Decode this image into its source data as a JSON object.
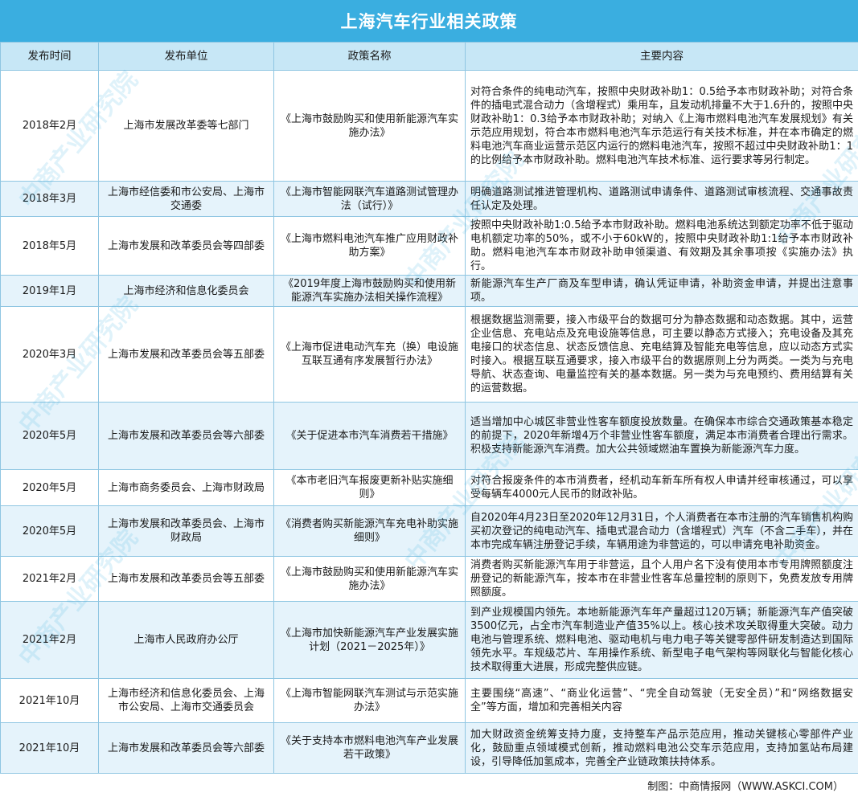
{
  "title": "上海汽车行业相关政策",
  "headers": [
    "发布时间",
    "发布单位",
    "政策名称",
    "主要内容"
  ],
  "rows": [
    {
      "date": "2018年2月",
      "org": "上海市发展改革委等七部门",
      "name": "《上海市鼓励购买和使用新能源汽车实施办法》",
      "content": "对符合条件的纯电动汽车，按照中央财政补助1：0.5给予本市财政补助；对符合条件的插电式混合动力（含增程式）乘用车，且发动机排量不大于1.6升的，按照中央财政补助1：0.3给予本市财政补助；对纳入《上海市燃料电池汽车发展规划》有关示范应用规划，符合本市燃料电池汽车示范运行有关技术标准，并在本市确定的燃料电池汽车商业运营示范区内运行的燃料电池汽车，按照不超过中央财政补助1：1的比例给予本市财政补助。燃料电池汽车技术标准、运行要求等另行制定。"
    },
    {
      "date": "2018年3月",
      "org": "上海市经信委和市公安局、上海市交通委",
      "name": "《上海市智能网联汽车道路测试管理办法（试行）》",
      "content": "明确道路测试推进管理机构、道路测试申请条件、道路测试审核流程、交通事故责任认定及处理。"
    },
    {
      "date": "2018年5月",
      "org": "上海市发展和改革委员会等四部委",
      "name": "《上海市燃料电池汽车推广应用财政补助方案》",
      "content": "按照中央财政补助1:0.5给予本市财政补助。燃料电池系统达到额定功率不低于驱动电机额定功率的50%，或不小于60kW的，按照中央财政补助1:1给予本市财政补助。燃料电池汽车本市财政补助申领渠道、有效期及其余事项按《实施办法》执行。"
    },
    {
      "date": "2019年1月",
      "org": "上海市经济和信息化委员会",
      "name": "《2019年度上海市鼓励购买和使用新能源汽车实施办法相关操作流程》",
      "content": "新能源汽车生产厂商及车型申请，确认凭证申请，补助资金申请，并提出注意事项。"
    },
    {
      "date": "2020年3月",
      "org": "上海市发展和改革委员会等五部委",
      "name": "《上海市促进电动汽车充（换）电设施互联互通有序发展暂行办法》",
      "content": "根据数据监测需要，接入市级平台的数据可分为静态数据和动态数据。其中，运营企业信息、充电站点及充电设施等信息，可主要以静态方式接入；充电设备及其充电接口的状态信息、状态反馈信息、充电结算及智能充电等信息，应以动态方式实时接入。根据互联互通要求，接入市级平台的数据原则上分为两类。一类为与充电导航、状态查询、电量监控有关的基本数据。另一类为与充电预约、费用结算有关的运营数据。"
    },
    {
      "date": "2020年5月",
      "org": "上海市发展和改革委员会等六部委",
      "name": "《关于促进本市汽车消费若干措施》",
      "content": "适当增加中心城区非营业性客车额度投放数量。在确保本市综合交通政策基本稳定的前提下，2020年新增4万个非营业性客车额度，满足本市消费者合理出行需求。积极支持新能源汽车消费。加大公共领域燃油车置换为新能源汽车力度。"
    },
    {
      "date": "2020年5月",
      "org": "上海市商务委员会、上海市财政局",
      "name": "《本市老旧汽车报废更新补贴实施细则》",
      "content": "对符合报废条件的本市消费者，经机动车新车所有权人申请并经审核通过，可以享受每辆车4000元人民币的财政补贴。"
    },
    {
      "date": "2020年5月",
      "org": "上海市发展和改革委员会、上海市财政局",
      "name": "《消费者购买新能源汽车充电补助实施细则》",
      "content": "自2020年4月23日至2020年12月31日，个人消费者在本市注册的汽车销售机构购买初次登记的纯电动汽车、插电式混合动力（含增程式）汽车（不含二手车），并在本市完成车辆注册登记手续，车辆用途为非营运的，可以申请充电补助资金。"
    },
    {
      "date": "2021年2月",
      "org": "上海市发展和改革委员会等五部委",
      "name": "《上海市鼓励购买和使用新能源汽车实施办法》",
      "content": "消费者购买新能源汽车用于非营运，且个人用户名下没有使用本市专用牌照额度注册登记的新能源汽车，按本市在非营业性客车总量控制的原则下，免费发放专用牌照额度。"
    },
    {
      "date": "2021年2月",
      "org": "上海市人民政府办公厅",
      "name": "《上海市加快新能源汽车产业发展实施计划（2021－2025年）》",
      "content": "到产业规模国内领先。本地新能源汽车年产量超过120万辆；新能源汽车产值突破3500亿元，占全市汽车制造业产值35%以上。核心技术攻关取得重大突破。动力电池与管理系统、燃料电池、驱动电机与电力电子等关键零部件研发制造达到国际领先水平。车规级芯片、车用操作系统、新型电子电气架构等网联化与智能化核心技术取得重大进展，形成完整供应链。"
    },
    {
      "date": "2021年10月",
      "org": "上海市经济和信息化委员会、上海市公安局、上海市交通委员会",
      "name": "《上海市智能网联汽车测试与示范实施办法》",
      "content": "主要围绕“高速”、“商业化运营”、“完全自动驾驶（无安全员）”和“网络数据安全”等方面，增加和完善相关内容"
    },
    {
      "date": "2021年10月",
      "org": "上海市发展和改革委员会等六部委",
      "name": "《关于支持本市燃料电池汽车产业发展若干政策》",
      "content": "加大财政资金统筹支持力度，支持整车产品示范应用，推动关键核心零部件产业化，鼓励重点领域模式创新，推动燃料电池公交车示范应用，支持加氢站布局建设，引导降低加氢成本，完善全产业链政策扶持体系。"
    }
  ],
  "footer": "制图：中商情报网（WWW.ASKCI.COM）",
  "watermark": "中商产业研究院",
  "colors": {
    "header_bar": "#3aaee0",
    "header_row": "#c7e7f6",
    "alt_row": "#e5f3fb",
    "border": "#8fc6e2"
  }
}
